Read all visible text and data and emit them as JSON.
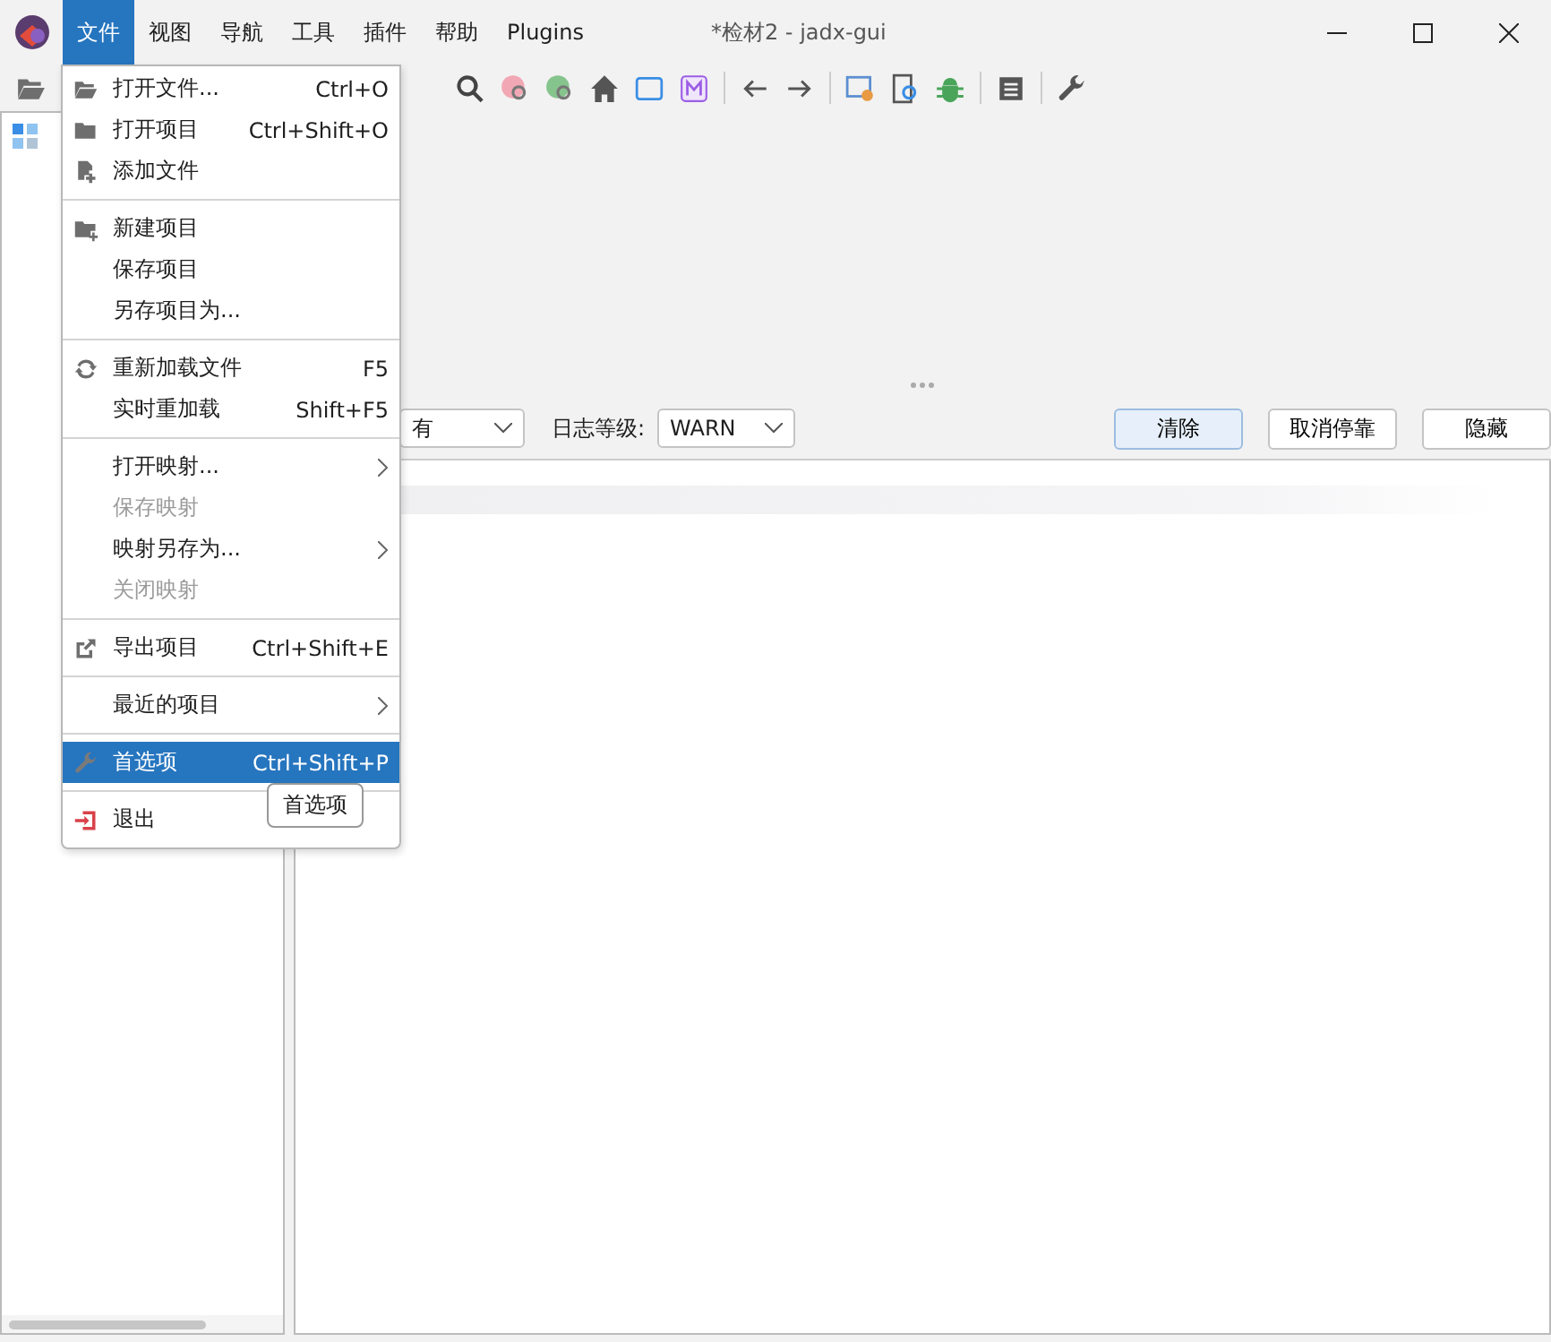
{
  "window": {
    "title": "*检材2 - jadx-gui"
  },
  "menubar": [
    {
      "label": "文件",
      "selected": true
    },
    {
      "label": "视图",
      "selected": false
    },
    {
      "label": "导航",
      "selected": false
    },
    {
      "label": "工具",
      "selected": false
    },
    {
      "label": "插件",
      "selected": false
    },
    {
      "label": "帮助",
      "selected": false
    },
    {
      "label": "Plugins",
      "selected": false
    }
  ],
  "menu": [
    {
      "kind": "item",
      "label": "打开文件...",
      "shortcut": "Ctrl+O",
      "disabled": false,
      "submenu": false,
      "selected": false
    },
    {
      "kind": "item",
      "label": "打开项目",
      "shortcut": "Ctrl+Shift+O",
      "disabled": false,
      "submenu": false,
      "selected": false
    },
    {
      "kind": "item",
      "label": "添加文件",
      "disabled": false,
      "submenu": false,
      "selected": false
    },
    {
      "kind": "separator"
    },
    {
      "kind": "item",
      "label": "新建项目",
      "disabled": false,
      "submenu": false,
      "selected": false
    },
    {
      "kind": "item",
      "label": "保存项目",
      "disabled": false,
      "submenu": false,
      "selected": false
    },
    {
      "kind": "item",
      "label": "另存项目为...",
      "disabled": false,
      "submenu": false,
      "selected": false
    },
    {
      "kind": "separator"
    },
    {
      "kind": "item",
      "label": "重新加载文件",
      "shortcut": "F5",
      "disabled": false,
      "submenu": false,
      "selected": false
    },
    {
      "kind": "item",
      "label": "实时重加载",
      "shortcut": "Shift+F5",
      "disabled": false,
      "submenu": false,
      "selected": false
    },
    {
      "kind": "separator"
    },
    {
      "kind": "item",
      "label": "打开映射...",
      "disabled": false,
      "submenu": true,
      "selected": false
    },
    {
      "kind": "item",
      "label": "保存映射",
      "disabled": true,
      "submenu": false,
      "selected": false
    },
    {
      "kind": "item",
      "label": "映射另存为...",
      "disabled": false,
      "submenu": true,
      "selected": false
    },
    {
      "kind": "item",
      "label": "关闭映射",
      "disabled": true,
      "submenu": false,
      "selected": false
    },
    {
      "kind": "separator"
    },
    {
      "kind": "item",
      "label": "导出项目",
      "shortcut": "Ctrl+Shift+E",
      "disabled": false,
      "submenu": false,
      "selected": false
    },
    {
      "kind": "separator"
    },
    {
      "kind": "item",
      "label": "最近的项目",
      "disabled": false,
      "submenu": true,
      "selected": false
    },
    {
      "kind": "separator"
    },
    {
      "kind": "item",
      "label": "首选项",
      "shortcut": "Ctrl+Shift+P",
      "disabled": false,
      "submenu": false,
      "selected": true
    },
    {
      "kind": "separator"
    },
    {
      "kind": "item",
      "label": "退出",
      "disabled": false,
      "submenu": false,
      "selected": false
    }
  ],
  "tooltip": "首选项",
  "log_panel": {
    "filter_value": "有",
    "level_label": "日志等级:",
    "level_value": "WARN",
    "buttons": [
      {
        "label": "清除",
        "default": true
      },
      {
        "label": "取消停靠",
        "default": false
      },
      {
        "label": "隐藏",
        "default": false
      }
    ]
  }
}
